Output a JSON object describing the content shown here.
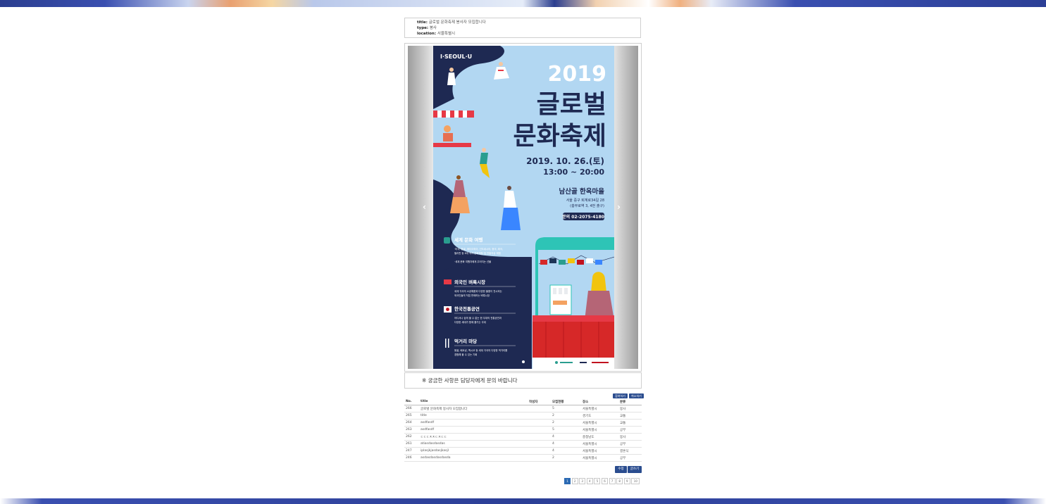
{
  "info": {
    "title_label": "title:",
    "title_value": "글로벌 문화축제 봉사자 모집합니다",
    "type_label": "type:",
    "type_value": "봉사",
    "location_label": "location:",
    "location_value": "서울특별시"
  },
  "poster": {
    "brand": "I·SEOUL·U",
    "year": "2019",
    "title_line1": "글로벌",
    "title_line2": "문화축제",
    "date": "2019. 10. 26.(토)",
    "time": "13:00 ~ 20:00",
    "venue": "남산골 한옥마을",
    "address_line1": "서울 중구 퇴계로34길 28",
    "address_line2": "(충무로역 3, 4번 출구)",
    "contact": "문의  02-2075-4180",
    "sections": [
      {
        "title": "세계 문화 여행",
        "line1": "·미국, 몽골, 에티오피아, 인도네시아, 중국, 태국,",
        "line2": "필리핀 등 8개 국가 문화체험 및 전통의상 체험",
        "line3": "·세계 문화 여행자에게 주어지는 선물"
      },
      {
        "title": "외국인 벼룩시장",
        "line1": "세계 각국의 소공예품과 다양한 물품이 전시되는",
        "line2": "외국인들의 직접 판매하는 벼룩시장",
        "line3": ""
      },
      {
        "title": "한국전통공연",
        "line1": "어디서나 쉽게 볼 수 없는 한 무대의 전통공연과",
        "line2": "다양한 세대가 함께 즐기는 무대",
        "line3": ""
      },
      {
        "title": "먹거리 마당",
        "line1": "몽골, 베트남, 멕시코 등 세계 각국의 다양한 먹거리를",
        "line2": "경험해 볼 수 있는 기회",
        "line3": ""
      }
    ],
    "flags_colors": [
      "#d62828",
      "#2a9d8f",
      "#ffffff",
      "#f1c40f",
      "#1d3557",
      "#c1121f",
      "#ffffff"
    ]
  },
  "notice": "※ 궁금한 사항은 담당자에게 문의 바랍니다",
  "top_buttons": {
    "apply": "참여하기",
    "cancel": "취소하기"
  },
  "table": {
    "headers": [
      "No.",
      "title",
      "작성자",
      "모집현황",
      "장소",
      "분류"
    ],
    "rows": [
      [
        "266",
        "글로벌 문화축제 봉사자 모집합니다",
        "",
        "5",
        "서울특별시",
        "봉사"
      ],
      [
        "265",
        "title",
        "",
        "2",
        "경기도",
        "교통"
      ],
      [
        "264",
        "asdfasdf",
        "",
        "2",
        "서울특별시",
        "교통"
      ],
      [
        "263",
        "asdfasdf",
        "",
        "5",
        "서울특별시",
        "공부"
      ],
      [
        "262",
        "ㄷㄷㄷㅈㅈㄷㅈㄷㄷ",
        "",
        "4",
        "충청남도",
        "봉사"
      ],
      [
        "261",
        "atiasdasdasdas",
        "",
        "4",
        "서울특별시",
        "공부"
      ],
      [
        "247",
        "iplasjkjasdasjkasjl",
        "",
        "4",
        "서울특별시",
        "결혼식"
      ],
      [
        "246",
        "asdasdasdasdasda",
        "",
        "2",
        "서울특별시",
        "공부"
      ]
    ]
  },
  "actions": {
    "edit": "수정",
    "delete": "글쓰기"
  },
  "pagination": [
    "1",
    "2",
    "3",
    "4",
    "5",
    "6",
    "7",
    "8",
    "9",
    "10"
  ],
  "pagination_active": "1",
  "colors": {
    "accent": "#2b4d8f",
    "poster_bg": "#b2d7f2",
    "poster_navy": "#1e2952"
  }
}
